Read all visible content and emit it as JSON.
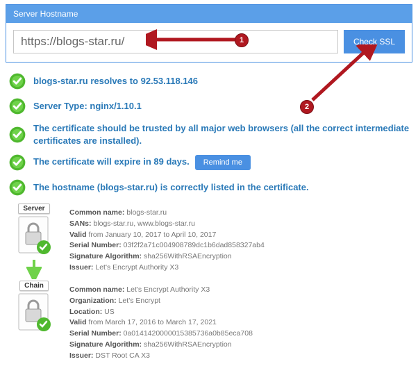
{
  "panel": {
    "title": "Server Hostname"
  },
  "input": {
    "value": "https://blogs-star.ru/"
  },
  "buttons": {
    "check": "Check SSL",
    "remind": "Remind me"
  },
  "annotations": {
    "badge1": "1",
    "badge2": "2"
  },
  "results": [
    "blogs-star.ru resolves to 92.53.118.146",
    "Server Type: nginx/1.10.1",
    "The certificate should be trusted by all major web browsers (all the correct intermediate certificates are installed).",
    "The certificate will expire in 89 days.",
    "The hostname (blogs-star.ru) is correctly listed in the certificate."
  ],
  "cert": {
    "server": {
      "label": "Server",
      "rows": {
        "cn_l": "Common name:",
        "cn_v": "blogs-star.ru",
        "sans_l": "SANs:",
        "sans_v": "blogs-star.ru, www.blogs-star.ru",
        "valid_l": "Valid",
        "valid_v": "from January 10, 2017 to April 10, 2017",
        "sn_l": "Serial Number:",
        "sn_v": "03f2f2a71c004908789dc1b6dad858327ab4",
        "sa_l": "Signature Algorithm:",
        "sa_v": "sha256WithRSAEncryption",
        "is_l": "Issuer:",
        "is_v": "Let's Encrypt Authority X3"
      }
    },
    "chain": {
      "label": "Chain",
      "rows": {
        "cn_l": "Common name:",
        "cn_v": "Let's Encrypt Authority X3",
        "org_l": "Organization:",
        "org_v": "Let's Encrypt",
        "loc_l": "Location:",
        "loc_v": "US",
        "valid_l": "Valid",
        "valid_v": "from March 17, 2016 to March 17, 2021",
        "sn_l": "Serial Number:",
        "sn_v": "0a0141420000015385736a0b85eca708",
        "sa_l": "Signature Algorithm:",
        "sa_v": "sha256WithRSAEncryption",
        "is_l": "Issuer:",
        "is_v": "DST Root CA X3"
      }
    }
  }
}
